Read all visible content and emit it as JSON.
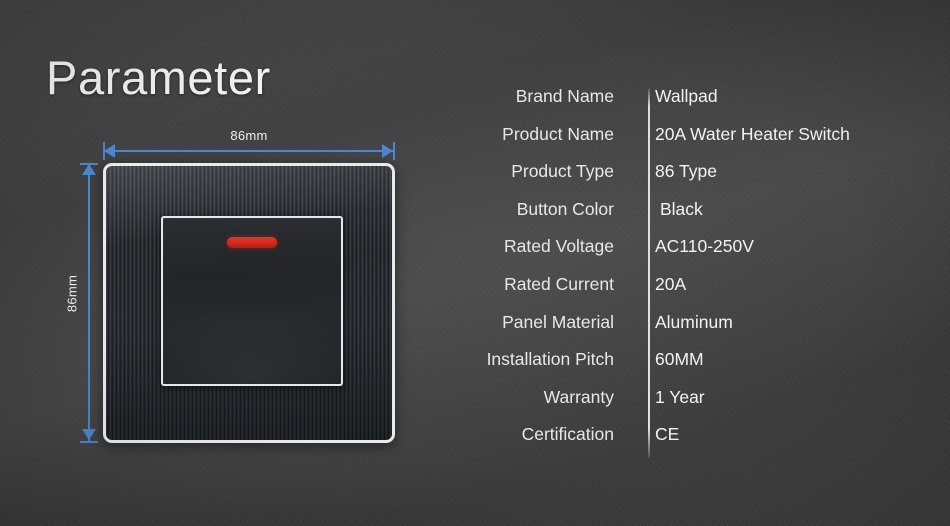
{
  "title": "Parameter",
  "figure": {
    "width_label": "86mm",
    "height_label": "86mm",
    "dimension_color": "#4c87d0",
    "indicator_color": "#d4291c",
    "panel_rim_color": "#e9eaec"
  },
  "specs": {
    "divider_color": "#ebebeb",
    "rows": [
      {
        "label": "Brand Name",
        "value": "Wallpad"
      },
      {
        "label": "Product Name",
        "value": "20A Water Heater Switch"
      },
      {
        "label": "Product Type",
        "value": "86 Type"
      },
      {
        "label": "Button Color",
        "value": "Black"
      },
      {
        "label": "Rated Voltage",
        "value": "AC110-250V"
      },
      {
        "label": "Rated Current",
        "value": "20A"
      },
      {
        "label": "Panel Material",
        "value": "Aluminum"
      },
      {
        "label": "Installation Pitch",
        "value": "60MM"
      },
      {
        "label": "Warranty",
        "value": "1 Year"
      },
      {
        "label": "Certification",
        "value": "CE"
      }
    ]
  }
}
